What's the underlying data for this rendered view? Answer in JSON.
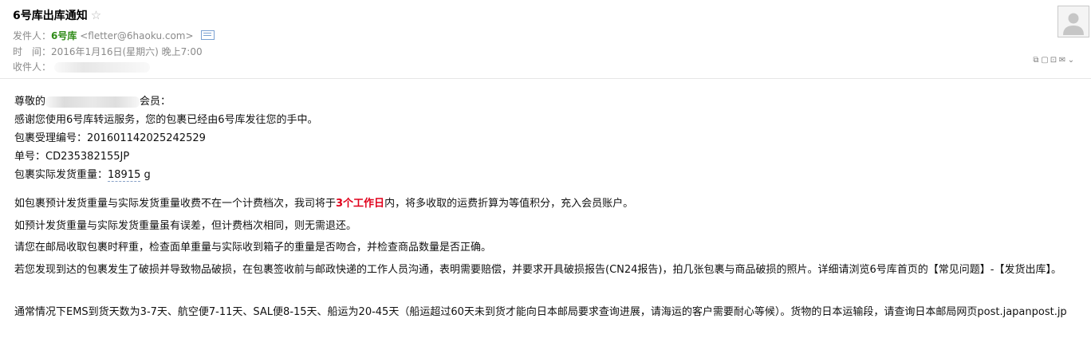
{
  "email": {
    "subject": "6号库出库通知",
    "star_glyph": "☆",
    "from_label": "发件人：",
    "from_name": "6号库",
    "from_address": "<fletter@6haoku.com>",
    "time_label": "时　间：",
    "time_value": "2016年1月16日(星期六) 晚上7:00",
    "to_label": "收件人：",
    "toolbar_icons": [
      "popout-icon",
      "print-icon",
      "expand-icon",
      "mail-icon",
      "more-icon"
    ]
  },
  "body": {
    "greeting_prefix": "尊敬的",
    "greeting_suffix": "会员：",
    "line_thanks": "感谢您使用6号库转运服务，您的包裹已经由6号库发往您的手中。",
    "tracking_label": "包裹受理编号：",
    "tracking_value": "201601142025242529",
    "shipment_label": "单号：",
    "shipment_value": "CD235382155JP",
    "weight_label": "包裹实际发货重量：",
    "weight_value": "18915",
    "weight_unit": " g",
    "p1_a": "如包裹预计发货重量与实际发货重量收费不在一个计费档次，我司将于",
    "p1_red": "3个工作日",
    "p1_b": "内，将多收取的运费折算为等值积分，充入会员账户。",
    "p2": "如预计发货重量与实际发货重量虽有误差，但计费档次相同，则无需退还。",
    "p3": "请您在邮局收取包裹时秤重，检查面单重量与实际收到箱子的重量是否吻合，并检查商品数量是否正确。",
    "p4": "若您发现到达的包裹发生了破损并导致物品破损，在包裹签收前与邮政快递的工作人员沟通，表明需要赔偿，并要求开具破损报告(CN24报告)，拍几张包裹与商品破损的照片。详细请浏览6号库首页的【常见问题】-【发货出库】。",
    "p5": "通常情况下EMS到货天数为3-7天、航空便7-11天、SAL便8-15天、船运为20-45天（船运超过60天未到货才能向日本邮局要求查询进展，请海运的客户需要耐心等候）。货物的日本运输段，请查询日本邮局网页post.japanpost.jp"
  }
}
